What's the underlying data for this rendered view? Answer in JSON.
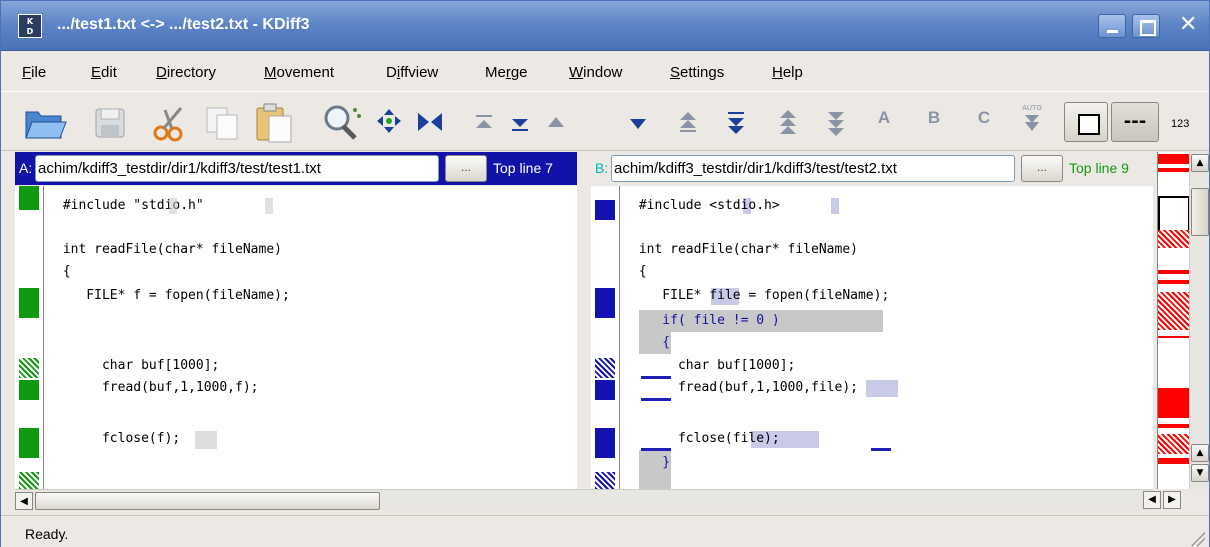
{
  "window": {
    "title": ".../test1.txt <-> .../test2.txt - KDiff3",
    "app_icon_text": "KDiff3"
  },
  "menu": [
    {
      "label": "File"
    },
    {
      "label": "Edit"
    },
    {
      "label": "Directory"
    },
    {
      "label": "Movement"
    },
    {
      "label": "Diffview"
    },
    {
      "label": "Merge"
    },
    {
      "label": "Window"
    },
    {
      "label": "Settings"
    },
    {
      "label": "Help"
    }
  ],
  "toolbar": {
    "icons": [
      "open-folder-icon",
      "save-icon",
      "cut-icon",
      "copy-icon",
      "paste-icon",
      "search-icon",
      "current-diff-icon",
      "dark-diff-icon",
      "first-diff-icon",
      "last-diff-icon",
      "prev-diff-icon",
      "next-diff-icon",
      "prev-conflict-icon",
      "next-conflict-icon",
      "prev-unsolved-icon",
      "next-unsolved-icon",
      "choose-a-icon",
      "choose-b-icon",
      "choose-c-icon",
      "auto-advance-icon"
    ],
    "choose_a": "A",
    "choose_b": "B",
    "choose_c": "C",
    "auto_label": "AUTO",
    "toggle_dash": "---",
    "line_numbers": "123"
  },
  "pane_a": {
    "label": "A:",
    "path": "achim/kdiff3_testdir/dir1/kdiff3/test/test1.txt",
    "browse": "...",
    "top_line": "Top line 7",
    "lines": [
      " #include \"stdio.h\"",
      "",
      " int readFile(char* fileName)",
      " {",
      "    FILE* f = fopen(fileName);",
      "",
      "",
      "      char buf[1000];",
      "      fread(buf,1,1000,f);",
      "",
      "      fclose(f);"
    ]
  },
  "pane_b": {
    "label": "B:",
    "path": "achim/kdiff3_testdir/dir1/kdiff3/test/test2.txt",
    "browse": "...",
    "top_line": "Top line 9",
    "lines": [
      " #include <stdio.h>",
      "",
      " int readFile(char* fileName)",
      " {",
      "    FILE* file = fopen(fileName);",
      "    if( file != 0 )",
      "    {",
      "      char buf[1000];",
      "      fread(buf,1,1000,file);",
      "",
      "      fclose(file);",
      "    }"
    ]
  },
  "colors": {
    "pane_a_accent": "#1212a8",
    "pane_b_accent": "#1212a8",
    "gutter_a": "#119911",
    "gutter_b": "#1212b0",
    "overview_red": "#ff0000",
    "title_blue": "#5b83c6"
  },
  "status": {
    "text": "Ready."
  }
}
